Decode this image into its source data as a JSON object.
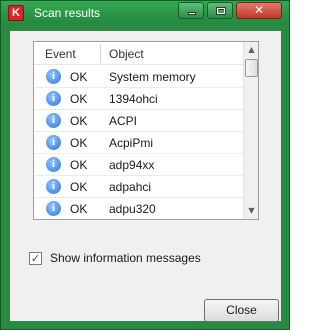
{
  "window": {
    "title": "Scan results",
    "app_icon_glyph": "K",
    "controls": {
      "minimize_icon": "minimize-icon",
      "maximize_icon": "maximize-icon",
      "close_glyph": "✕"
    }
  },
  "list": {
    "columns": {
      "event": "Event",
      "object": "Object"
    },
    "rows": [
      {
        "icon": "info-icon",
        "event": "OK",
        "object": "System memory"
      },
      {
        "icon": "info-icon",
        "event": "OK",
        "object": "1394ohci"
      },
      {
        "icon": "info-icon",
        "event": "OK",
        "object": "ACPI"
      },
      {
        "icon": "info-icon",
        "event": "OK",
        "object": "AcpiPmi"
      },
      {
        "icon": "info-icon",
        "event": "OK",
        "object": "adp94xx"
      },
      {
        "icon": "info-icon",
        "event": "OK",
        "object": "adpahci"
      },
      {
        "icon": "info-icon",
        "event": "OK",
        "object": "adpu320"
      }
    ],
    "info_glyph": "i"
  },
  "options": {
    "show_info_label": "Show information messages",
    "show_info_checked": true,
    "check_glyph": "✓"
  },
  "buttons": {
    "close_label": "Close"
  },
  "colors": {
    "frame": "#2a8a43",
    "close_button_red": "#c4362a",
    "info_blue": "#2a73d6"
  }
}
